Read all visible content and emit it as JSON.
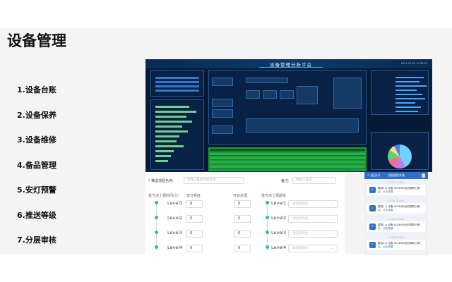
{
  "slide": {
    "title": "设备管理",
    "menu": [
      {
        "label": "1.设备台账"
      },
      {
        "label": "2.设备保养"
      },
      {
        "label": "3.设备维修"
      },
      {
        "label": "4.备品管理"
      },
      {
        "label": "5.安灯预警"
      },
      {
        "label": "6.推送等级"
      },
      {
        "label": "7.分层审核"
      }
    ]
  },
  "dashboard": {
    "title": "设备管理分析平台",
    "date": "2021-07-20",
    "time": "17:30:59",
    "colors": {
      "background": "#071a35",
      "accent": "#2ea8ff",
      "table_green": "#27b347"
    }
  },
  "form": {
    "name_label": "* 推送流程名称:",
    "name_placeholder": "请输入推送流程名称",
    "remark_label": "备注:",
    "remark_placeholder": "请输入备注",
    "col_headers": {
      "elapsed": "首节点上报时间(分)",
      "andon_freq": "安灯频度",
      "start": "开始处理",
      "report": "首节点上报超级"
    },
    "levels_left": [
      {
        "label": "Level1",
        "value": "0"
      },
      {
        "label": "Level2",
        "value": "0"
      },
      {
        "label": "Level3",
        "value": "0"
      },
      {
        "label": "Level4",
        "value": "0"
      }
    ],
    "levels_right": [
      {
        "label": "Level1",
        "value": "0",
        "select_placeholder": "请选择岗位"
      },
      {
        "label": "Level2",
        "value": "0",
        "select_placeholder": "请选择岗位"
      },
      {
        "label": "Level3",
        "value": "0",
        "select_placeholder": "请选择岗位"
      },
      {
        "label": "Level4",
        "value": "0",
        "select_placeholder": "请选择岗位"
      }
    ]
  },
  "mobile": {
    "back_label": "< 返回(1)",
    "title": "设备管理系统",
    "user_icon": "person-icon",
    "messages": [
      {
        "time": "13:53 17:45:1",
        "text": "模具1-A 设备 A0084所设的模具已确认，",
        "link": "点击查看"
      },
      {
        "time": "13:53 17:45:1",
        "text": "模具1-A 设备 A0084所设的模具已确认，",
        "link": "点击查看"
      },
      {
        "time": "13:53 17:45:1",
        "text": "模具1-A 设备 A0084所设的模具已确认，",
        "link": "点击查看"
      },
      {
        "time": "13:53 17:45:1",
        "text": "模具1-A 设备 A0084所设的模具已确认，",
        "link": "点击查看"
      }
    ]
  }
}
